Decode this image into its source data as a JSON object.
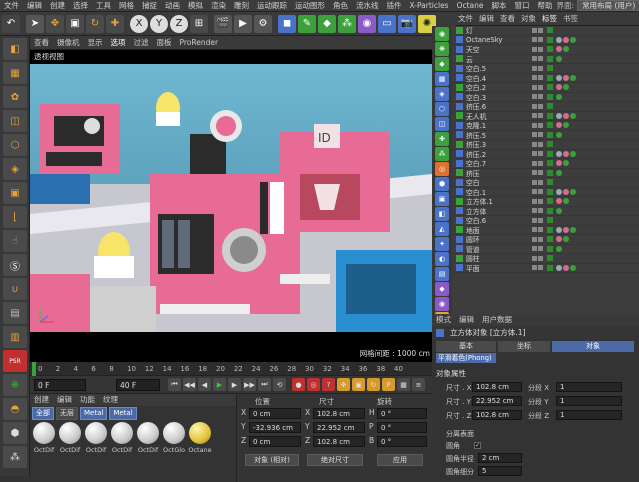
{
  "menubar": {
    "items": [
      "文件",
      "编辑",
      "创建",
      "选择",
      "工具",
      "网格",
      "捕捉",
      "动画",
      "模拟",
      "渲染",
      "雕刻",
      "运动跟踪",
      "运动图形",
      "角色",
      "流水线",
      "插件",
      "X-Particles",
      "Octane",
      "脚本",
      "窗口",
      "帮助"
    ],
    "layout_label": "界面:",
    "layout_value": "常用布局 (用户)"
  },
  "toolbar": {
    "undo_icon": "undo-icon",
    "colors": {
      "green": "#3ca03c",
      "blue": "#4a72c8",
      "orange": "#d89a2a"
    }
  },
  "viewport": {
    "menu": [
      "查看",
      "摄像机",
      "显示",
      "选项",
      "过滤",
      "面板",
      "ProRender"
    ],
    "label": "透视视图",
    "grid_label": "网格间距 : 1000 cm"
  },
  "timeline": {
    "ticks": [
      "0",
      "2",
      "4",
      "6",
      "8",
      "10",
      "12",
      "14",
      "16",
      "18",
      "20",
      "22",
      "24",
      "26",
      "28",
      "30",
      "32",
      "34",
      "36",
      "38",
      "40"
    ],
    "start_frame": "0 F",
    "end_frame": "40 F"
  },
  "materials": {
    "tabs": [
      "创建",
      "编辑",
      "功能",
      "纹理"
    ],
    "filters": [
      "全部",
      "无层",
      "Metal",
      "Metal"
    ],
    "items": [
      {
        "label": "OctDif",
        "kind": "white"
      },
      {
        "label": "OctDif",
        "kind": "white"
      },
      {
        "label": "OctDif",
        "kind": "white"
      },
      {
        "label": "OctDif",
        "kind": "white"
      },
      {
        "label": "OctDif",
        "kind": "white"
      },
      {
        "label": "OctGlo",
        "kind": "white"
      },
      {
        "label": "Octane",
        "kind": "yellow"
      }
    ]
  },
  "coordinates": {
    "headers": [
      "位置",
      "尺寸",
      "旋转"
    ],
    "rows": [
      {
        "axis": "X",
        "pos": "0 cm",
        "size": "102.8 cm",
        "rot_axis": "H",
        "rot": "0 °"
      },
      {
        "axis": "Y",
        "pos": "-32.936 cm",
        "size": "22.952 cm",
        "rot_axis": "P",
        "rot": "0 °"
      },
      {
        "axis": "Z",
        "pos": "0 cm",
        "size": "102.8 cm",
        "rot_axis": "B",
        "rot": "0 °"
      }
    ],
    "mode_object": "对象 (相对)",
    "mode_size": "绝对尺寸",
    "apply": "应用"
  },
  "objects": {
    "tabs": [
      "文件",
      "编辑",
      "查看",
      "对象",
      "标签",
      "书签"
    ],
    "rows": [
      {
        "name": "灯"
      },
      {
        "name": "OctaneSky"
      },
      {
        "name": "天空"
      },
      {
        "name": "云"
      },
      {
        "name": "空白.5"
      },
      {
        "name": "空白.4"
      },
      {
        "name": "空白.2"
      },
      {
        "name": "空白.3"
      },
      {
        "name": "挤压.6"
      },
      {
        "name": "无人机"
      },
      {
        "name": "克隆.1"
      },
      {
        "name": "挤压.5"
      },
      {
        "name": "挤压.3"
      },
      {
        "name": "挤压.2"
      },
      {
        "name": "空白.7"
      },
      {
        "name": "挤压"
      },
      {
        "name": "空白"
      },
      {
        "name": "空白.1"
      },
      {
        "name": "立方体.1"
      },
      {
        "name": "立方体"
      },
      {
        "name": "空白.6"
      },
      {
        "name": "地面"
      },
      {
        "name": "圆环"
      },
      {
        "name": "管道"
      },
      {
        "name": "圆柱"
      },
      {
        "name": "平面"
      }
    ]
  },
  "attributes": {
    "tabs": [
      "模式",
      "编辑",
      "用户数据"
    ],
    "title": "立方体对象 [立方体.1]",
    "subtabs": [
      "基本",
      "坐标",
      "对象"
    ],
    "phong": "平滑着色(Phong)",
    "section": "对象属性",
    "fields": [
      {
        "label": "尺寸 . X",
        "value": "102.8 cm",
        "seg_label": "分段 X",
        "seg": "1"
      },
      {
        "label": "尺寸 . Y",
        "value": "22.952 cm",
        "seg_label": "分段 Y",
        "seg": "1"
      },
      {
        "label": "尺寸 . Z",
        "value": "102.8 cm",
        "seg_label": "分段 Z",
        "seg": "1"
      }
    ],
    "sep_label": "分离表面",
    "fillet_label": "圆角",
    "fillet_radius_label": "圆角半径",
    "fillet_radius": "2 cm",
    "fillet_sub_label": "圆角细分",
    "fillet_sub": "5"
  }
}
